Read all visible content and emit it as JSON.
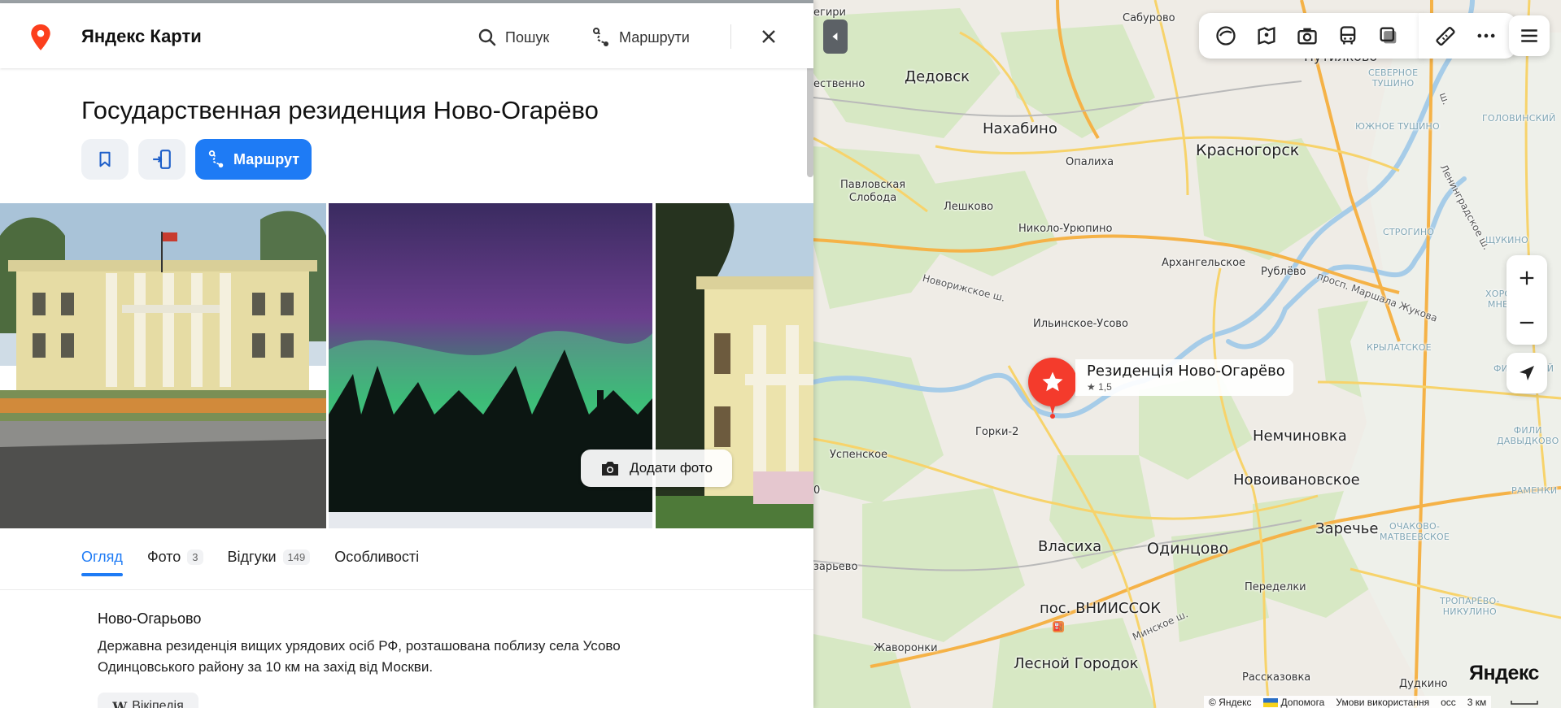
{
  "header": {
    "brand": "Яндекс Карти",
    "search_label": "Пошук",
    "routes_label": "Маршрути"
  },
  "place": {
    "title": "Государственная резиденция Ново-Огарёво",
    "route_button": "Маршрут",
    "add_photo": "Додати фото",
    "tabs": [
      {
        "label": "Огляд",
        "count": ""
      },
      {
        "label": "Фото",
        "count": "3"
      },
      {
        "label": "Відгуки",
        "count": "149"
      },
      {
        "label": "Особливості",
        "count": ""
      }
    ],
    "about_title": "Ново-Огарьово",
    "about_text": "Державна резиденція вищих урядових осіб РФ, розташована поблизу села Усово Одинцовського району за 10 км на захід від Москви.",
    "wiki_label": "Вікіпедія"
  },
  "map": {
    "marker_title": "Резиденція Ново-Огарёво",
    "marker_rating": "1,5",
    "labels": {
      "saburovo": "Сабурово",
      "putilkovo": "Путилково",
      "dedovsk": "Дедовск",
      "nakhabino": "Нахабино",
      "krasnogorsk": "Красногорск",
      "opalikha": "Опалиха",
      "pavlovskaya": "Павловская\nСлобода",
      "leshkovo": "Лешково",
      "nikolo": "Николо-Урюпино",
      "arkhangelskoe": "Архангельское",
      "rublevo": "Рублёво",
      "ilinskoe": "Ильинское-Усово",
      "gorki": "Горки-2",
      "uspenskoe": "Успенское",
      "nemchinovka": "Немчиновка",
      "novoivanovskoe": "Новоивановское",
      "zarechye": "Заречье",
      "vlasikha": "Власиха",
      "odintsovo": "Одинцово",
      "peredelki": "Переделки",
      "vniissok": "пос. ВНИИССОК",
      "zhavoronki": "Жаворонки",
      "lesnoy": "Лесной Городок",
      "rasskazovka": "Рассказовка",
      "dudkino": "Дудкино",
      "zarevo": "зарьево",
      "estvenno": "ественно",
      "egiri": "егири",
      "zero": "0",
      "mosrentgen": "осс"
    },
    "districts": {
      "severnoe_tushino": "СЕВЕРНОЕ\nТУШИНО",
      "yuzhnoe_tushino": "ЮЖНОЕ ТУШИНО",
      "golovinsky": "ГОЛОВИНСКИЙ",
      "strogino": "СТРОГИНО",
      "shchukino": "ЩУКИНО",
      "khoroshevo": "ХОРОШЕВО-\nМНЕВНИКИ",
      "krylatskoe": "КРЫЛАТСКОЕ",
      "fili": "ФИЛИ\nДАВЫДКОВО",
      "filevsky": "ФИЛЕВСКИЙ\nПАРК",
      "ochakovo": "ОЧАКОВО-\nМАТВЕЕВСКОЕ",
      "ramenki": "РАМЕНКИ",
      "troparevo": "ТРОПАРЁВО-\nНИКУЛИНО"
    },
    "roads": {
      "novorizhskoe": "Новорижское ш.",
      "minskoe": "Минское ш.",
      "marshala": "просп. Маршала Жукова",
      "leningradskoe": "Ленинградское ш.",
      "sh": "ш."
    },
    "logo": "Яндекс",
    "copyright": "© Яндекс",
    "help": "Допомога",
    "terms": "Умови використання",
    "scale": "3 км"
  }
}
